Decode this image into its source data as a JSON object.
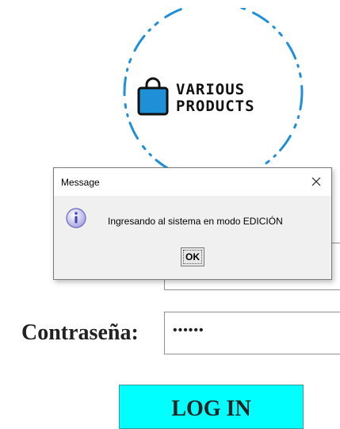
{
  "logo": {
    "line1": "VARIOUS",
    "line2": "PRODUCTS",
    "icon": "shopping-bag-icon",
    "accent_color": "#1f8fd8"
  },
  "login": {
    "password_label": "Contraseña:",
    "password_value": "••••••",
    "login_button": "LOG IN",
    "button_color": "#00ffff"
  },
  "dialog": {
    "title": "Message",
    "message": "Ingresando al sistema en modo EDICIÓN",
    "ok_label": "OK",
    "icon": "info-icon",
    "close_icon": "close-icon"
  }
}
